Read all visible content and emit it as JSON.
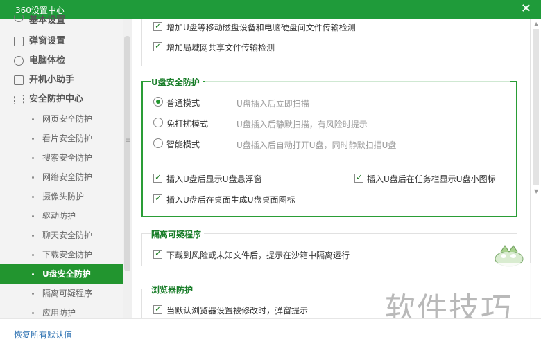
{
  "window": {
    "title": "360设置中心",
    "close_icon": "close-icon"
  },
  "sidebar": {
    "items": [
      {
        "label": "基本设置",
        "icon": "gear-icon"
      },
      {
        "label": "弹窗设置",
        "icon": "window-icon"
      },
      {
        "label": "电脑体检",
        "icon": "checkup-icon"
      },
      {
        "label": "开机小助手",
        "icon": "power-icon"
      },
      {
        "label": "安全防护中心",
        "icon": "shield-grid-icon"
      }
    ],
    "subitems": [
      "网页安全防护",
      "看片安全防护",
      "搜索安全防护",
      "网络安全防护",
      "摄像头防护",
      "驱动防护",
      "聊天安全防护",
      "下载安全防护",
      "U盘安全防护",
      "隔离可疑程序",
      "应用防护"
    ],
    "active_subitem": "U盘安全防护"
  },
  "content": {
    "top_checks": [
      "增加U盘等移动磁盘设备和电脑硬盘间文件传输检测",
      "增加局域网共享文件传输检测"
    ],
    "usb": {
      "title": "U盘安全防护",
      "modes": [
        {
          "label": "普通模式",
          "hint": "U盘插入后立即扫描",
          "selected": true
        },
        {
          "label": "免打扰模式",
          "hint": "U盘插入后静默扫描，有风险时提示",
          "selected": false
        },
        {
          "label": "智能模式",
          "hint": "U盘插入后自动打开U盘，同时静默扫描U盘",
          "selected": false
        }
      ],
      "checks": [
        "插入U盘后显示U盘悬浮窗",
        "插入U盘后在任务栏显示U盘小图标",
        "插入U盘后在桌面生成U盘桌面图标"
      ]
    },
    "quarantine": {
      "title": "隔离可疑程序",
      "check": "下载到风险或未知文件后，提示在沙箱中隔离运行"
    },
    "browser": {
      "title": "浏览器防护",
      "check": "当默认浏览器设置被修改时，弹窗提示"
    }
  },
  "footer": {
    "restore_label": "恢复所有默认值"
  },
  "watermark": "软件技巧",
  "colors": {
    "brand": "#1f9b3a",
    "active": "#22952f",
    "section_title": "#1a7e2a",
    "link": "#2a6fb0"
  }
}
